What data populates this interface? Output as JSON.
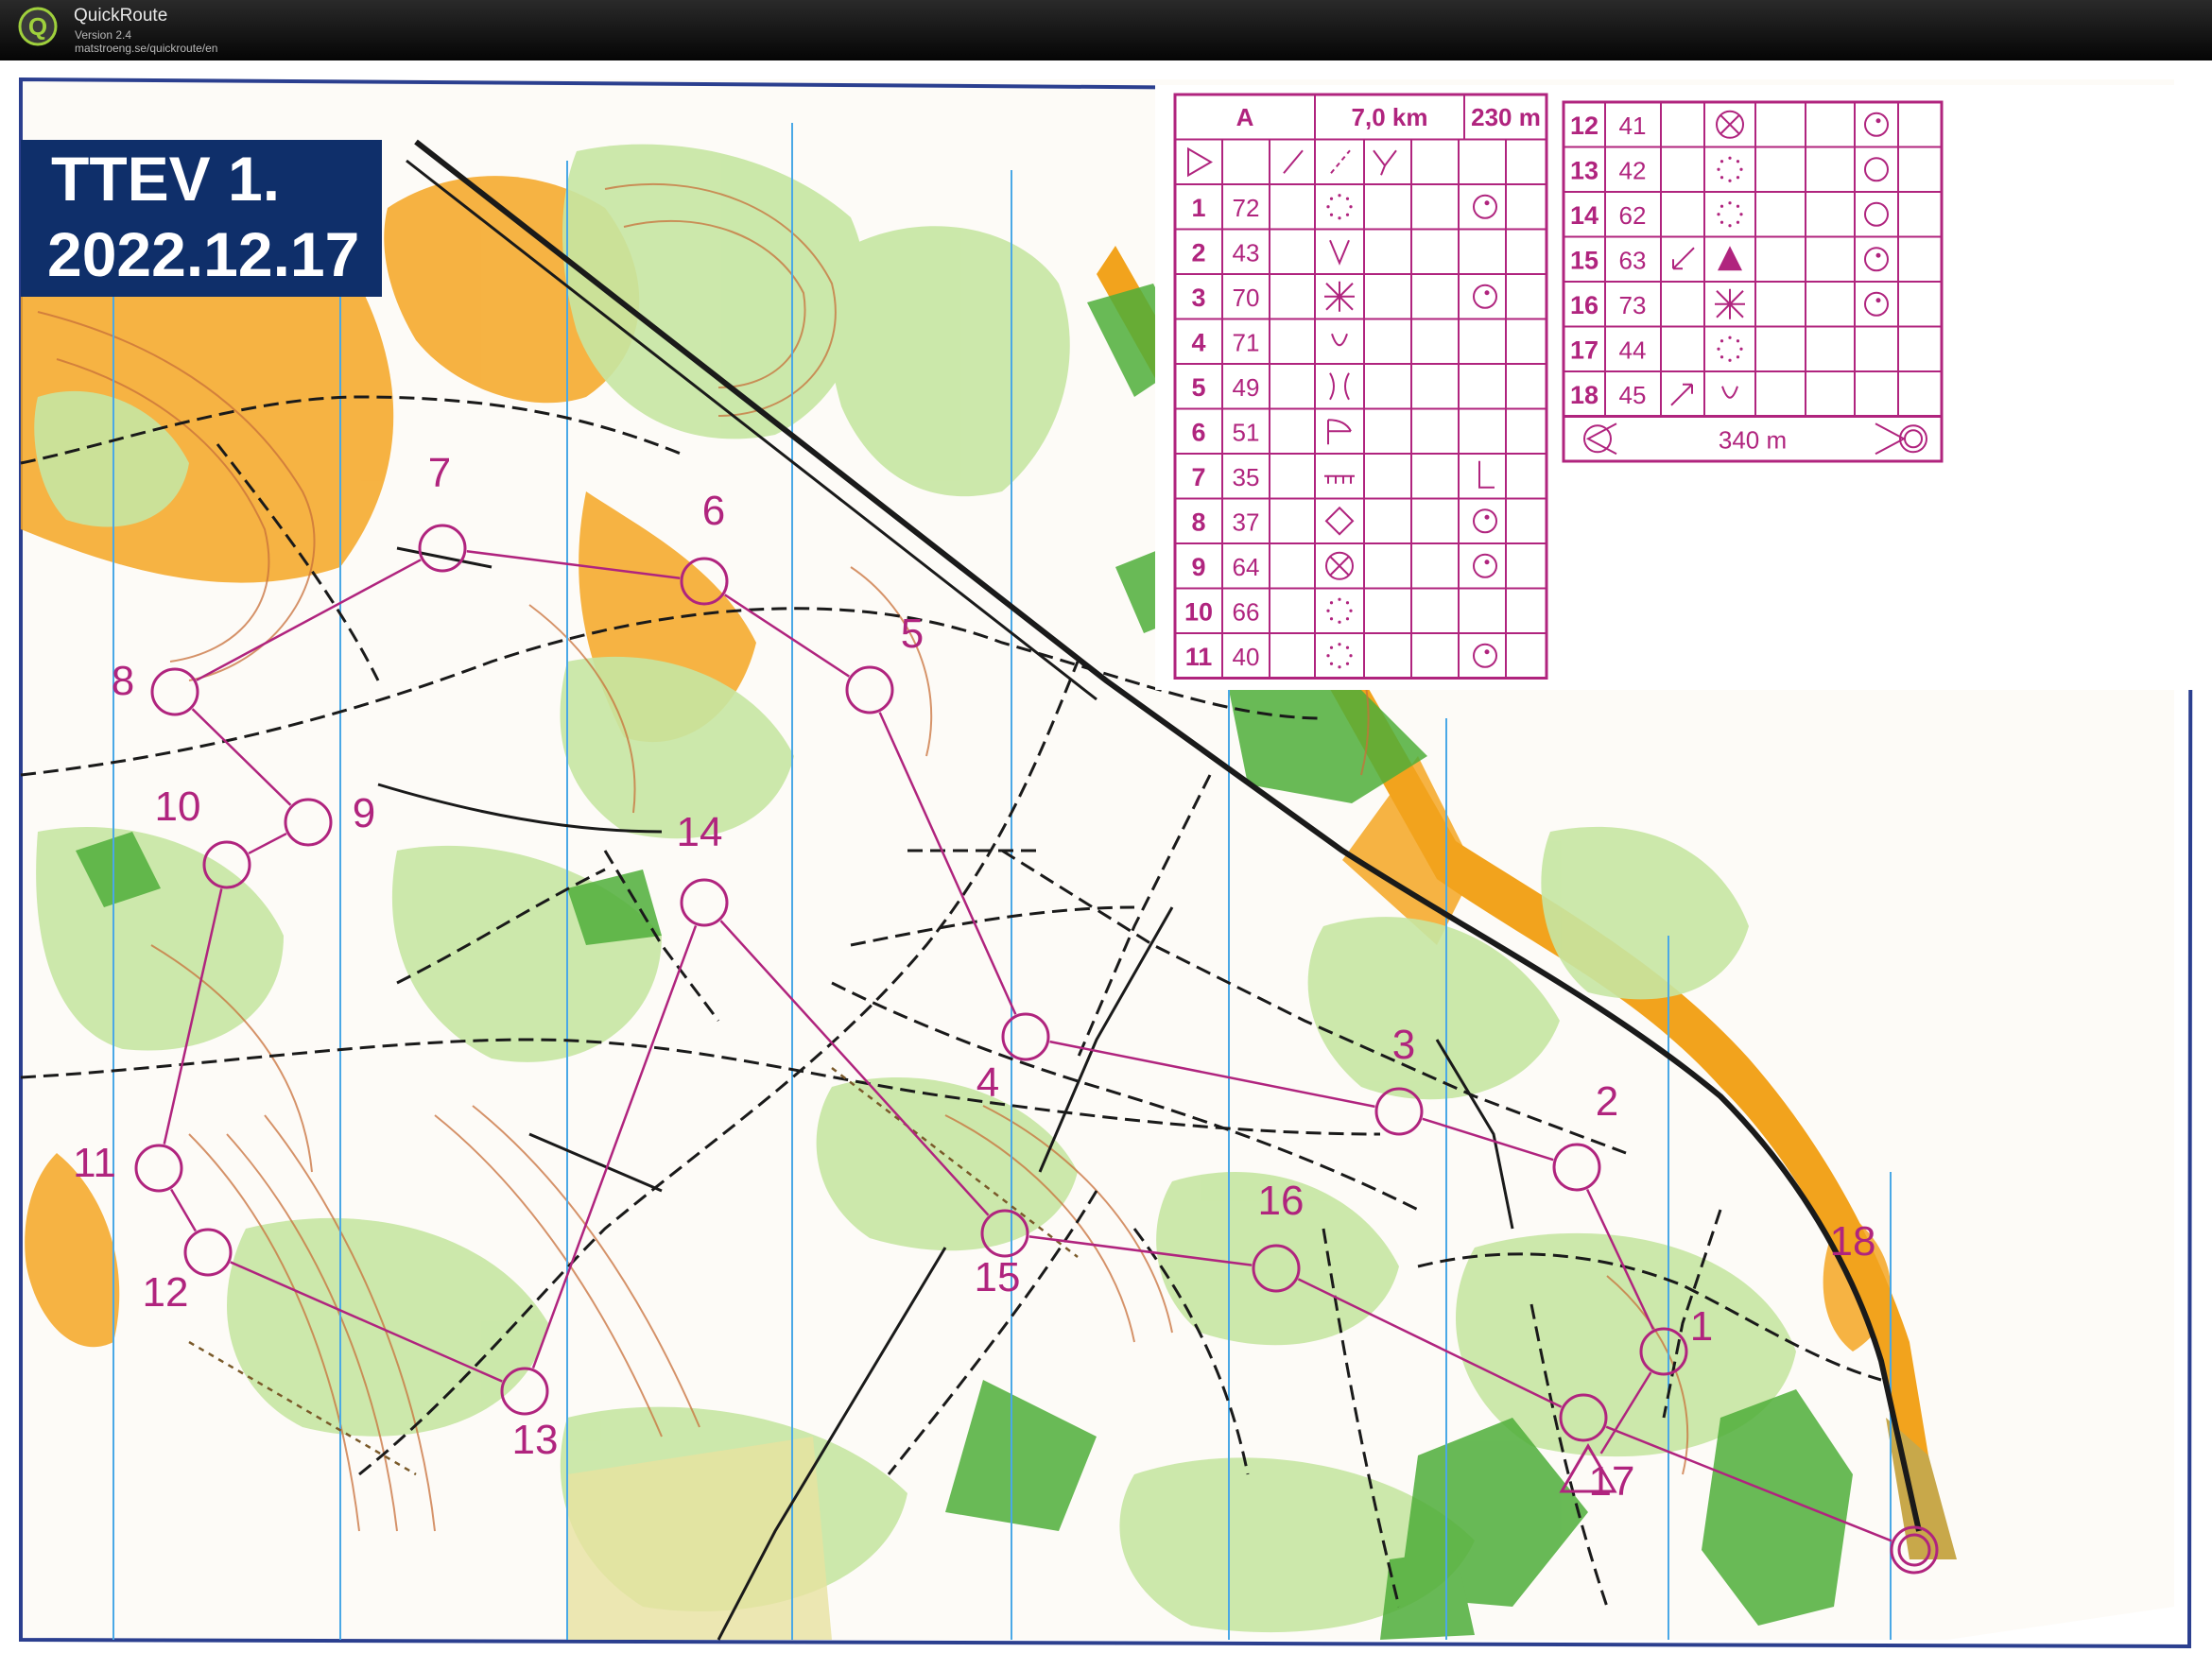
{
  "app": {
    "name": "QuickRoute",
    "version": "Version 2.4",
    "url": "matstroeng.se/quickroute/en",
    "logo_letter": "Q"
  },
  "map": {
    "title_line1": "TTEV 1.",
    "title_line2": "2022.12.17",
    "colors": {
      "course": "#b0247e",
      "contour": "#c8703a",
      "forest_light": "#c6e6a2",
      "forest_dark": "#4fae3a",
      "open_land": "#f5a623",
      "track": "#1a1a1a",
      "north_lines": "#4aa8e6",
      "title_bg": "#0f2f6a"
    },
    "control_labels": [
      "1",
      "2",
      "3",
      "4",
      "5",
      "6",
      "7",
      "8",
      "9",
      "10",
      "11",
      "12",
      "13",
      "14",
      "15",
      "16",
      "17",
      "18"
    ]
  },
  "control_description": {
    "course": "A",
    "length": "7,0 km",
    "climb": "230 m",
    "finish_distance": "340 m",
    "rows": [
      {
        "num": "1",
        "code": "72"
      },
      {
        "num": "2",
        "code": "43"
      },
      {
        "num": "3",
        "code": "70"
      },
      {
        "num": "4",
        "code": "71"
      },
      {
        "num": "5",
        "code": "49"
      },
      {
        "num": "6",
        "code": "51"
      },
      {
        "num": "7",
        "code": "35"
      },
      {
        "num": "8",
        "code": "37"
      },
      {
        "num": "9",
        "code": "64"
      },
      {
        "num": "10",
        "code": "66"
      },
      {
        "num": "11",
        "code": "40"
      },
      {
        "num": "12",
        "code": "41"
      },
      {
        "num": "13",
        "code": "42"
      },
      {
        "num": "14",
        "code": "62"
      },
      {
        "num": "15",
        "code": "63"
      },
      {
        "num": "16",
        "code": "73"
      },
      {
        "num": "17",
        "code": "44"
      },
      {
        "num": "18",
        "code": "45"
      }
    ]
  }
}
